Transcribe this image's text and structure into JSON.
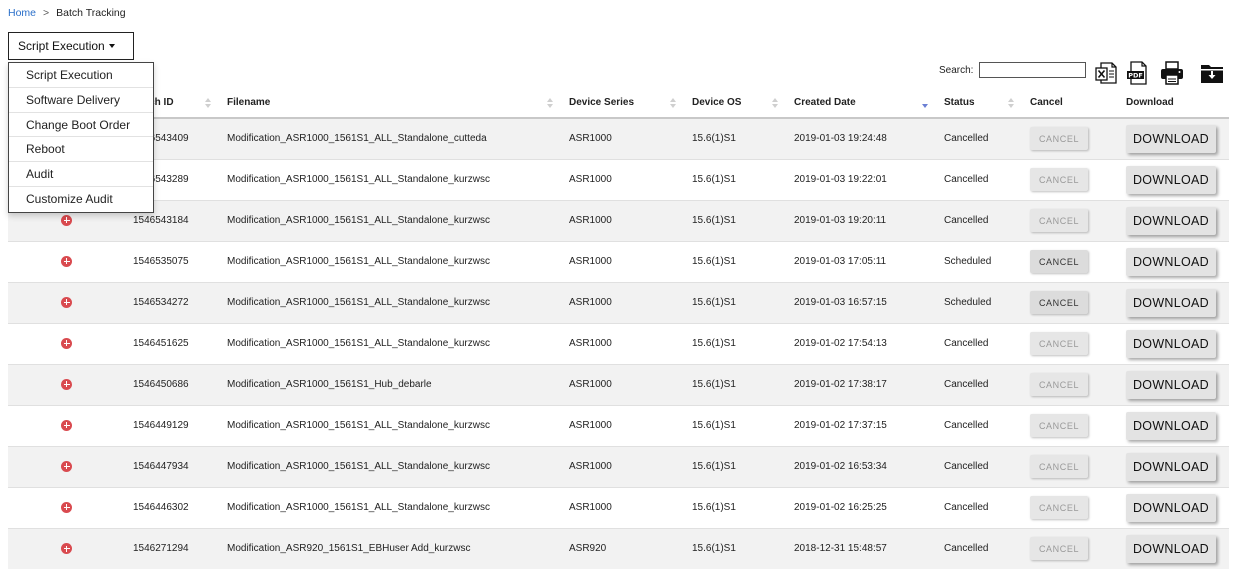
{
  "breadcrumb": {
    "home": "Home",
    "separator": ">",
    "current": "Batch Tracking"
  },
  "dropdown": {
    "label": "Script Execution",
    "items": [
      "Script Execution",
      "Software Delivery",
      "Change Boot Order",
      "Reboot",
      "Audit",
      "Customize Audit"
    ]
  },
  "search": {
    "label": "Search:",
    "value": ""
  },
  "toolbar": {
    "icons": [
      "excel-icon",
      "pdf-icon",
      "print-icon",
      "download-folder-icon"
    ]
  },
  "table": {
    "columns": [
      "",
      "Batch ID",
      "Filename",
      "Device Series",
      "Device OS",
      "Created Date",
      "Status",
      "Cancel",
      "Download"
    ],
    "sort_column": "Created Date",
    "sort_direction": "descending",
    "rows": [
      {
        "batch_id": "1546543409",
        "filename": "Modification_ASR1000_1561S1_ALL_Standalone_cutteda",
        "device_series": "ASR1000",
        "device_os": "15.6(1)S1",
        "created_date": "2019-01-03 19:24:48",
        "status": "Cancelled",
        "cancel": "CANCEL",
        "cancel_enabled": false,
        "download": "DOWNLOAD"
      },
      {
        "batch_id": "1546543289",
        "filename": "Modification_ASR1000_1561S1_ALL_Standalone_kurzwsc",
        "device_series": "ASR1000",
        "device_os": "15.6(1)S1",
        "created_date": "2019-01-03 19:22:01",
        "status": "Cancelled",
        "cancel": "CANCEL",
        "cancel_enabled": false,
        "download": "DOWNLOAD"
      },
      {
        "batch_id": "1546543184",
        "filename": "Modification_ASR1000_1561S1_ALL_Standalone_kurzwsc",
        "device_series": "ASR1000",
        "device_os": "15.6(1)S1",
        "created_date": "2019-01-03 19:20:11",
        "status": "Cancelled",
        "cancel": "CANCEL",
        "cancel_enabled": false,
        "download": "DOWNLOAD"
      },
      {
        "batch_id": "1546535075",
        "filename": "Modification_ASR1000_1561S1_ALL_Standalone_kurzwsc",
        "device_series": "ASR1000",
        "device_os": "15.6(1)S1",
        "created_date": "2019-01-03 17:05:11",
        "status": "Scheduled",
        "cancel": "CANCEL",
        "cancel_enabled": true,
        "download": "DOWNLOAD"
      },
      {
        "batch_id": "1546534272",
        "filename": "Modification_ASR1000_1561S1_ALL_Standalone_kurzwsc",
        "device_series": "ASR1000",
        "device_os": "15.6(1)S1",
        "created_date": "2019-01-03 16:57:15",
        "status": "Scheduled",
        "cancel": "CANCEL",
        "cancel_enabled": true,
        "download": "DOWNLOAD"
      },
      {
        "batch_id": "1546451625",
        "filename": "Modification_ASR1000_1561S1_ALL_Standalone_kurzwsc",
        "device_series": "ASR1000",
        "device_os": "15.6(1)S1",
        "created_date": "2019-01-02 17:54:13",
        "status": "Cancelled",
        "cancel": "CANCEL",
        "cancel_enabled": false,
        "download": "DOWNLOAD"
      },
      {
        "batch_id": "1546450686",
        "filename": "Modification_ASR1000_1561S1_Hub_debarle",
        "device_series": "ASR1000",
        "device_os": "15.6(1)S1",
        "created_date": "2019-01-02 17:38:17",
        "status": "Cancelled",
        "cancel": "CANCEL",
        "cancel_enabled": false,
        "download": "DOWNLOAD"
      },
      {
        "batch_id": "1546449129",
        "filename": "Modification_ASR1000_1561S1_ALL_Standalone_kurzwsc",
        "device_series": "ASR1000",
        "device_os": "15.6(1)S1",
        "created_date": "2019-01-02 17:37:15",
        "status": "Cancelled",
        "cancel": "CANCEL",
        "cancel_enabled": false,
        "download": "DOWNLOAD"
      },
      {
        "batch_id": "1546447934",
        "filename": "Modification_ASR1000_1561S1_ALL_Standalone_kurzwsc",
        "device_series": "ASR1000",
        "device_os": "15.6(1)S1",
        "created_date": "2019-01-02 16:53:34",
        "status": "Cancelled",
        "cancel": "CANCEL",
        "cancel_enabled": false,
        "download": "DOWNLOAD"
      },
      {
        "batch_id": "1546446302",
        "filename": "Modification_ASR1000_1561S1_ALL_Standalone_kurzwsc",
        "device_series": "ASR1000",
        "device_os": "15.6(1)S1",
        "created_date": "2019-01-02 16:25:25",
        "status": "Cancelled",
        "cancel": "CANCEL",
        "cancel_enabled": false,
        "download": "DOWNLOAD"
      },
      {
        "batch_id": "1546271294",
        "filename": "Modification_ASR920_1561S1_EBHuser Add_kurzwsc",
        "device_series": "ASR920",
        "device_os": "15.6(1)S1",
        "created_date": "2018-12-31 15:48:57",
        "status": "Cancelled",
        "cancel": "CANCEL",
        "cancel_enabled": false,
        "download": "DOWNLOAD"
      }
    ]
  },
  "colors": {
    "link": "#2a6fc9",
    "expand_icon": "#d94a4f",
    "sort_active": "#6b7fd4"
  }
}
